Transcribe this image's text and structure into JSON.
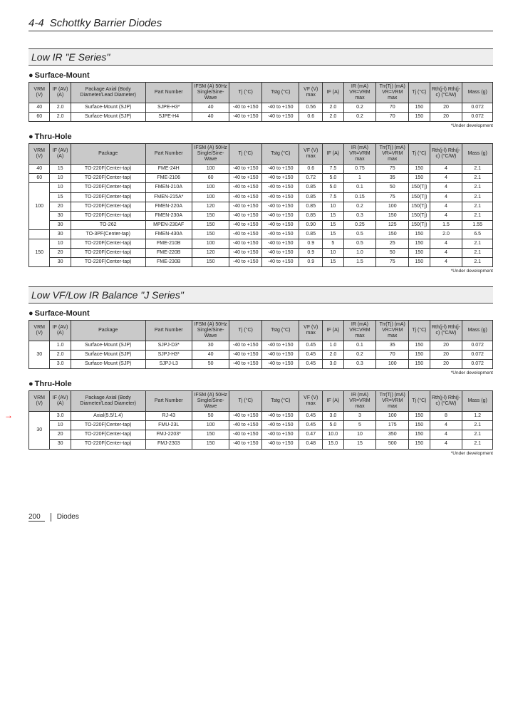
{
  "doc": {
    "section_number": "4-4",
    "section_name": "Schottky Barrier Diodes",
    "page_number": "200",
    "footer_category": "Diodes"
  },
  "notes": {
    "under_dev": "*Under development"
  },
  "headers": {
    "vrm": "VRM (V)",
    "if_av": "IF (AV) (A)",
    "package": "Package",
    "package_axial": "Package Axial (Body Diameter/Lead Diameter)",
    "part_number": "Part Number",
    "ifsm": "IFSM (A) 50Hz Single/Sine-Wave",
    "tj": "Tj (°C)",
    "tstg": "Tstg (°C)",
    "vf": "VF (V) max",
    "if_meas": "IF (A)",
    "ir": "IR (mA) VR=VRM max",
    "trr": "Trr(Tj) (mA) VR=VRM max",
    "tj_max": "Tj (°C)",
    "rth": "Rth(j-l) Rth(j-c) (°C/W)",
    "mass": "Mass (g)"
  },
  "sections": [
    {
      "title": "Low IR  \"E Series\"",
      "tables": [
        {
          "subtitle": "Surface-Mount",
          "use_axial_header": true,
          "has_note": true,
          "rows": [
            {
              "vrm": "40",
              "if": "2.0",
              "pkg": "Surface-Mount (SJP)",
              "pn": "SJPE-H3*",
              "ifsm": "40",
              "tj": "-40 to +150",
              "tstg": "-40 to +150",
              "vf": "0.56",
              "ifm": "2.0",
              "ir": "0.2",
              "trr": "70",
              "tjm": "150",
              "rth": "20",
              "mass": "0.072"
            },
            {
              "vrm": "60",
              "if": "2.0",
              "pkg": "Surface-Mount (SJP)",
              "pn": "SJPE-H4",
              "ifsm": "40",
              "tj": "-40 to +150",
              "tstg": "-40 to +150",
              "vf": "0.6",
              "ifm": "2.0",
              "ir": "0.2",
              "trr": "70",
              "tjm": "150",
              "rth": "20",
              "mass": "0.072"
            }
          ]
        },
        {
          "subtitle": "Thru-Hole",
          "use_axial_header": false,
          "has_note": true,
          "rows": [
            {
              "vrm": "40",
              "if": "15",
              "pkg": "TO-220F(Center-tap)",
              "pn": "FME-24H",
              "ifsm": "100",
              "tj": "-40 to +150",
              "tstg": "-40 to +150",
              "vf": "0.6",
              "ifm": "7.5",
              "ir": "0.75",
              "trr": "75",
              "tjm": "150",
              "rth": "4",
              "mass": "2.1"
            },
            {
              "vrm": "60",
              "if": "10",
              "pkg": "TO-220F(Center-tap)",
              "pn": "FME-2106",
              "ifsm": "60",
              "tj": "-40 to +150",
              "tstg": "-40 to +150",
              "vf": "0.72",
              "ifm": "5.0",
              "ir": "1",
              "trr": "35",
              "tjm": "150",
              "rth": "4",
              "mass": "2.1"
            },
            {
              "vrm": "100",
              "vrm_span": 5,
              "if": "10",
              "pkg": "TO-220F(Center-tap)",
              "pn": "FMEN-210A",
              "ifsm": "100",
              "tj": "-40 to +150",
              "tstg": "-40 to +150",
              "vf": "0.85",
              "ifm": "5.0",
              "ir": "0.1",
              "trr": "50",
              "tjm": "150(Tj)",
              "rth": "4",
              "mass": "2.1"
            },
            {
              "if": "15",
              "pkg": "TO-220F(Center-tap)",
              "pn": "FMEN-215A*",
              "ifsm": "100",
              "tj": "-40 to +150",
              "tstg": "-40 to +150",
              "vf": "0.85",
              "ifm": "7.5",
              "ir": "0.15",
              "trr": "75",
              "tjm": "150(Tj)",
              "rth": "4",
              "mass": "2.1"
            },
            {
              "if": "20",
              "pkg": "TO-220F(Center-tap)",
              "pn": "FMEN-220A",
              "ifsm": "120",
              "tj": "-40 to +150",
              "tstg": "-40 to +150",
              "vf": "0.85",
              "ifm": "10",
              "ir": "0.2",
              "trr": "100",
              "tjm": "150(Tj)",
              "rth": "4",
              "mass": "2.1"
            },
            {
              "if": "30",
              "pkg": "TO-220F(Center-tap)",
              "pn": "FMEN-230A",
              "ifsm": "150",
              "tj": "-40 to +150",
              "tstg": "-40 to +150",
              "vf": "0.85",
              "ifm": "15",
              "ir": "0.3",
              "trr": "150",
              "tjm": "150(Tj)",
              "rth": "4",
              "mass": "2.1"
            },
            {
              "if": "30",
              "pkg": "TO-262",
              "pn": "MPEN-230AF",
              "ifsm": "150",
              "tj": "-40 to +150",
              "tstg": "-40 to +150",
              "vf": "0.90",
              "ifm": "15",
              "ir": "0.25",
              "trr": "125",
              "tjm": "150(Tj)",
              "rth": "1.5",
              "mass": "1.55"
            },
            {
              "if": "30",
              "pkg": "TO-3PF(Center-tap)",
              "pn": "FMEN-430A",
              "ifsm": "150",
              "tj": "-40 to +150",
              "tstg": "-40 to +150",
              "vf": "0.85",
              "ifm": "15",
              "ir": "0.5",
              "trr": "150",
              "tjm": "150",
              "rth": "2.0",
              "mass": "6.5"
            },
            {
              "vrm": "150",
              "vrm_span": 3,
              "if": "10",
              "pkg": "TO-220F(Center-tap)",
              "pn": "FME-210B",
              "ifsm": "100",
              "tj": "-40 to +150",
              "tstg": "-40 to +150",
              "vf": "0.9",
              "ifm": "5",
              "ir": "0.5",
              "trr": "25",
              "tjm": "150",
              "rth": "4",
              "mass": "2.1"
            },
            {
              "if": "20",
              "pkg": "TO-220F(Center-tap)",
              "pn": "FME-220B",
              "ifsm": "120",
              "tj": "-40 to +150",
              "tstg": "-40 to +150",
              "vf": "0.9",
              "ifm": "10",
              "ir": "1.0",
              "trr": "50",
              "tjm": "150",
              "rth": "4",
              "mass": "2.1"
            },
            {
              "if": "30",
              "pkg": "TO-220F(Center-tap)",
              "pn": "FME-230B",
              "ifsm": "150",
              "tj": "-40 to +150",
              "tstg": "-40 to +150",
              "vf": "0.9",
              "ifm": "15",
              "ir": "1.5",
              "trr": "75",
              "tjm": "150",
              "rth": "4",
              "mass": "2.1"
            }
          ]
        }
      ]
    },
    {
      "title": "Low VF/Low IR Balance  \"J Series\"",
      "tables": [
        {
          "subtitle": "Surface-Mount",
          "use_axial_header": false,
          "has_note": true,
          "rows": [
            {
              "vrm": "30",
              "vrm_span": 3,
              "if": "1.0",
              "pkg": "Surface-Mount (SJP)",
              "pn": "SJPJ-D3*",
              "ifsm": "30",
              "tj": "-40 to +150",
              "tstg": "-40 to +150",
              "vf": "0.45",
              "ifm": "1.0",
              "ir": "0.1",
              "trr": "35",
              "tjm": "150",
              "rth": "20",
              "mass": "0.072"
            },
            {
              "if": "2.0",
              "pkg": "Surface-Mount (SJP)",
              "pn": "SJPJ-H3*",
              "ifsm": "40",
              "tj": "-40 to +150",
              "tstg": "-40 to +150",
              "vf": "0.45",
              "ifm": "2.0",
              "ir": "0.2",
              "trr": "70",
              "tjm": "150",
              "rth": "20",
              "mass": "0.072"
            },
            {
              "if": "3.0",
              "pkg": "Surface-Mount (SJP)",
              "pn": "SJPJ-L3",
              "ifsm": "50",
              "tj": "-40 to +150",
              "tstg": "-40 to +150",
              "vf": "0.45",
              "ifm": "3.0",
              "ir": "0.3",
              "trr": "100",
              "tjm": "150",
              "rth": "20",
              "mass": "0.072"
            }
          ]
        },
        {
          "subtitle": "Thru-Hole",
          "use_axial_header": true,
          "has_note": true,
          "rows": [
            {
              "vrm": "30",
              "vrm_span": 4,
              "if": "3.0",
              "pkg": "Axial(5.5/1.4)",
              "pn": "RJ-43",
              "ifsm": "50",
              "tj": "-40 to +150",
              "tstg": "-40 to +150",
              "vf": "0.45",
              "ifm": "3.0",
              "ir": "3",
              "trr": "100",
              "tjm": "150",
              "rth": "8",
              "mass": "1.2"
            },
            {
              "if": "10",
              "pkg": "TO-220F(Center-tap)",
              "pn": "FMU-23L",
              "ifsm": "100",
              "tj": "-40 to +150",
              "tstg": "-40 to +150",
              "vf": "0.45",
              "ifm": "5.0",
              "ir": "5",
              "trr": "175",
              "tjm": "150",
              "rth": "4",
              "mass": "2.1"
            },
            {
              "if": "20",
              "pkg": "TO-220F(Center-tap)",
              "pn": "FMJ-2203*",
              "ifsm": "150",
              "tj": "-40 to +150",
              "tstg": "-40 to +150",
              "vf": "0.47",
              "ifm": "10.0",
              "ir": "10",
              "trr": "350",
              "tjm": "150",
              "rth": "4",
              "mass": "2.1"
            },
            {
              "if": "30",
              "pkg": "TO-220F(Center-tap)",
              "pn": "FMJ-2303",
              "ifsm": "150",
              "tj": "-40 to +150",
              "tstg": "-40 to +150",
              "vf": "0.48",
              "ifm": "15.0",
              "ir": "15",
              "trr": "500",
              "tjm": "150",
              "rth": "4",
              "mass": "2.1"
            }
          ]
        }
      ]
    }
  ]
}
